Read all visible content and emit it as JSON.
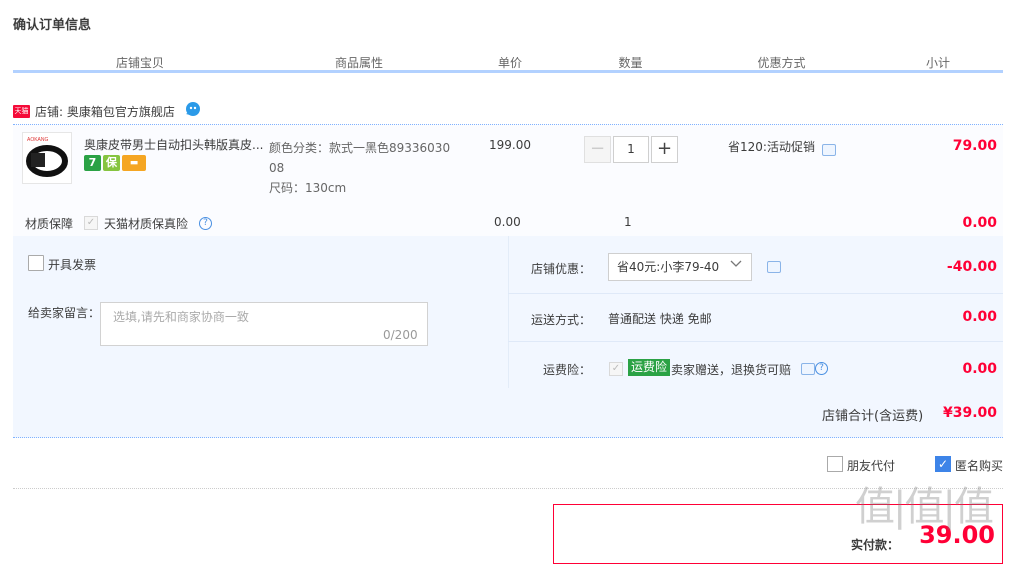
{
  "page_title": "确认订单信息",
  "columns": [
    "店铺宝贝",
    "商品属性",
    "单价",
    "数量",
    "优惠方式",
    "小计"
  ],
  "shop": {
    "badge": "天猫",
    "label": "店铺: 奥康箱包官方旗舰店"
  },
  "item": {
    "title": "奥康皮带男士自动扣头韩版真皮...",
    "badges": [
      {
        "text": "7",
        "color": "#2ba245"
      },
      {
        "text": "保",
        "color": "#86c440"
      },
      {
        "text": "▬",
        "color": "#f5a623"
      }
    ],
    "attr_color": "颜色分类：款式一黑色8933603008",
    "attr_size": "尺码：130cm",
    "price": "199.00",
    "quantity": "1",
    "promo": "省120:活动促销",
    "subtotal": "79.00"
  },
  "insurance": {
    "label": "材质保障",
    "name": "天猫材质保真险",
    "price": "0.00",
    "qty": "1",
    "subtotal": "0.00"
  },
  "invoice_label": "开具发票",
  "message": {
    "label": "给卖家留言：",
    "placeholder": "选填,请先和商家协商一致",
    "count": "0/200"
  },
  "shop_discount": {
    "label": "店铺优惠：",
    "selected": "省40元:小李79-40",
    "amount": "-40.00"
  },
  "shipping": {
    "label": "运送方式：",
    "value": "普通配送 快递 免邮",
    "amount": "0.00"
  },
  "freight_insurance": {
    "label": "运费险：",
    "tag": "运费险",
    "text": "卖家赠送，退换货可赔",
    "amount": "0.00"
  },
  "shop_total": {
    "label": "店铺合计(含运费)",
    "value": "¥39.00"
  },
  "friend_pay_label": "朋友代付",
  "anonymous_label": "匿名购买",
  "pay": {
    "label": "实付款：",
    "value": "39.00"
  },
  "watermark": "值|值|值"
}
